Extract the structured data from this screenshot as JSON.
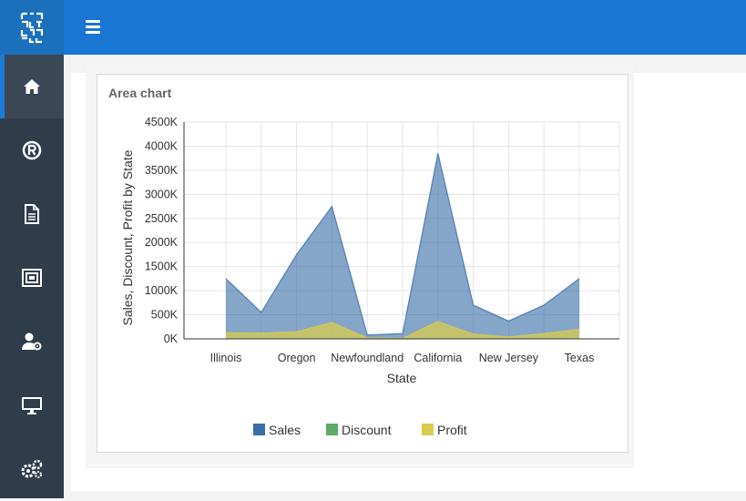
{
  "app": {
    "logo_name": "app-logo"
  },
  "sidebar": {
    "items": [
      {
        "icon": "home-icon",
        "active": true
      },
      {
        "icon": "registered-icon",
        "active": false
      },
      {
        "icon": "document-icon",
        "active": false
      },
      {
        "icon": "resize-icon",
        "active": false
      },
      {
        "icon": "user-settings-icon",
        "active": false
      },
      {
        "icon": "monitor-icon",
        "active": false
      },
      {
        "icon": "gears-icon",
        "active": false
      }
    ]
  },
  "widget": {
    "title": "Area chart"
  },
  "colors": {
    "sales": "#3a6ea8",
    "discount": "#5fa86a",
    "profit": "#d9cc4e",
    "topbar": "#1976d2",
    "sidebar": "#2f3d4a"
  },
  "chart_data": {
    "type": "area",
    "title": "Area chart",
    "xlabel": "State",
    "ylabel": "Sales, Discount, Profit by State",
    "ylim": [
      0,
      4500000
    ],
    "y_ticks": [
      "0K",
      "500K",
      "1000K",
      "1500K",
      "2000K",
      "2500K",
      "3000K",
      "3500K",
      "4000K",
      "4500K"
    ],
    "categories": [
      "Illinois",
      "",
      "Oregon",
      "",
      "Newfoundland",
      "",
      "California",
      "",
      "New Jersey",
      "",
      "Texas"
    ],
    "x_tick_labels": [
      "Illinois",
      "Oregon",
      "Newfoundland",
      "California",
      "New Jersey",
      "Texas"
    ],
    "stacked": true,
    "grid": true,
    "legend_position": "bottom",
    "series": [
      {
        "name": "Sales",
        "values": [
          1250000,
          550000,
          1750000,
          2750000,
          80000,
          110000,
          3850000,
          700000,
          370000,
          700000,
          1250000
        ]
      },
      {
        "name": "Discount",
        "values": [
          2000,
          1500,
          2500,
          3000,
          200,
          300,
          4000,
          1500,
          1000,
          1500,
          2000
        ]
      },
      {
        "name": "Profit",
        "values": [
          130000,
          120000,
          150000,
          340000,
          20000,
          10000,
          360000,
          100000,
          40000,
          110000,
          200000
        ]
      }
    ]
  }
}
